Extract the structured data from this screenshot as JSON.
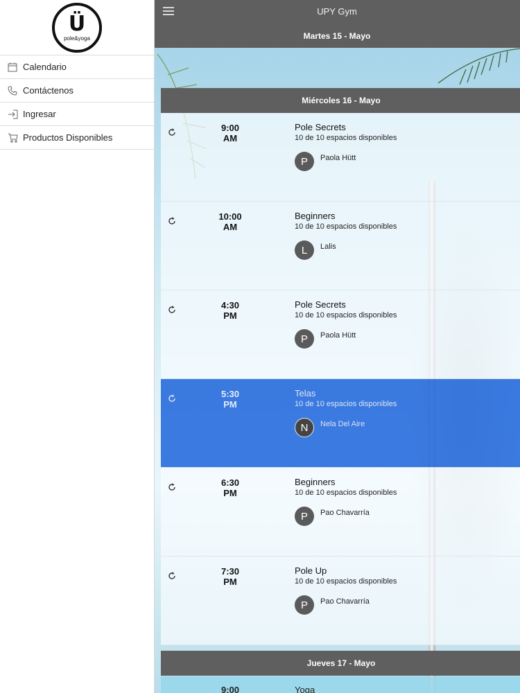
{
  "sidebar": {
    "logo": {
      "mark": "Ü",
      "text": "pole&yoga"
    },
    "items": [
      {
        "label": "Calendario",
        "icon": "calendar-icon"
      },
      {
        "label": "Contáctenos",
        "icon": "phone-icon"
      },
      {
        "label": "Ingresar",
        "icon": "login-icon"
      },
      {
        "label": "Productos Disponibles",
        "icon": "cart-icon"
      }
    ]
  },
  "header": {
    "title": "UPY Gym",
    "menu_icon": "hamburger-icon"
  },
  "days": [
    {
      "label": "Martes 15 - Mayo"
    },
    {
      "label": "Miércoles 16 - Mayo"
    },
    {
      "label": "Jueves 17 - Mayo"
    }
  ],
  "classes": [
    {
      "time_hm": "9:00",
      "time_ampm": "AM",
      "name": "Pole Secrets",
      "spots": "10 de 10 espacios disponibles",
      "avatar": "P",
      "instructor": "Paola Hütt",
      "selected": false
    },
    {
      "time_hm": "10:00",
      "time_ampm": "AM",
      "name": "Beginners",
      "spots": "10 de 10 espacios disponibles",
      "avatar": "L",
      "instructor": "Lalis",
      "selected": false
    },
    {
      "time_hm": "4:30",
      "time_ampm": "PM",
      "name": "Pole Secrets",
      "spots": "10 de 10 espacios disponibles",
      "avatar": "P",
      "instructor": "Paola Hütt",
      "selected": false
    },
    {
      "time_hm": "5:30",
      "time_ampm": "PM",
      "name": "Telas",
      "spots": "10 de 10 espacios disponibles",
      "avatar": "N",
      "instructor": "Nela Del Aire",
      "selected": true
    },
    {
      "time_hm": "6:30",
      "time_ampm": "PM",
      "name": "Beginners",
      "spots": "10 de 10 espacios disponibles",
      "avatar": "P",
      "instructor": "Pao Chavarría",
      "selected": false
    },
    {
      "time_hm": "7:30",
      "time_ampm": "PM",
      "name": "Pole Up",
      "spots": "10 de 10 espacios disponibles",
      "avatar": "P",
      "instructor": "Pao Chavarría",
      "selected": false
    }
  ],
  "next_day_preview": {
    "time": "9:00",
    "name": "Yoga"
  },
  "colors": {
    "header": "#5f5f5f",
    "selected": "#2369dc",
    "avatar": "#5a5a5a"
  }
}
